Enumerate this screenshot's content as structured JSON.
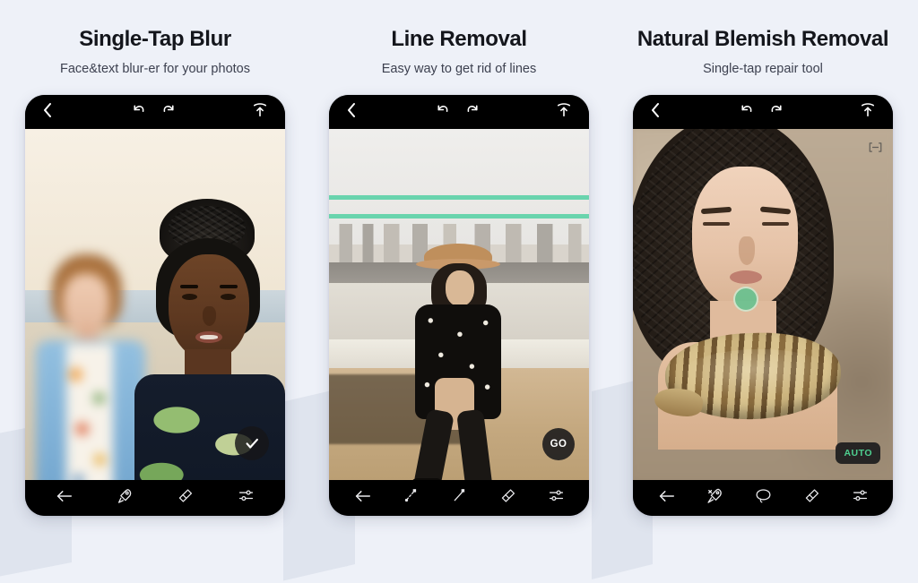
{
  "background_color": "#eef1f8",
  "panels": [
    {
      "title": "Single-Tap Blur",
      "subtitle": "Face&text blur-er for your photos",
      "topbar": {
        "back": "back-chevron-icon",
        "undo": "undo-icon",
        "redo": "redo-icon",
        "export": "export-icon"
      },
      "bottombar": [
        {
          "name": "back-arrow-icon",
          "label": "Back"
        },
        {
          "name": "blur-brush-icon",
          "label": "Blur brush"
        },
        {
          "name": "eraser-icon",
          "label": "Eraser"
        },
        {
          "name": "adjust-sliders-icon",
          "label": "Adjust"
        }
      ],
      "action": {
        "type": "check",
        "label": "✓"
      }
    },
    {
      "title": "Line Removal",
      "subtitle": "Easy way to get rid of lines",
      "topbar": {
        "back": "back-chevron-icon",
        "undo": "undo-icon",
        "redo": "redo-icon",
        "export": "export-icon"
      },
      "bottombar": [
        {
          "name": "back-arrow-icon",
          "label": "Back"
        },
        {
          "name": "dotted-line-tool-icon",
          "label": "Point line"
        },
        {
          "name": "solid-line-tool-icon",
          "label": "Straight line"
        },
        {
          "name": "eraser-icon",
          "label": "Eraser"
        },
        {
          "name": "adjust-sliders-icon",
          "label": "Adjust"
        }
      ],
      "action": {
        "type": "go",
        "label": "GO"
      },
      "overlay": {
        "line_highlight_color": "#5bd1a6",
        "line_count": 2
      }
    },
    {
      "title": "Natural Blemish Removal",
      "subtitle": "Single-tap repair tool",
      "topbar": {
        "back": "back-chevron-icon",
        "undo": "undo-icon",
        "redo": "redo-icon",
        "export": "export-icon"
      },
      "bottombar": [
        {
          "name": "back-arrow-icon",
          "label": "Back"
        },
        {
          "name": "heal-tool-icon",
          "label": "Heal"
        },
        {
          "name": "lasso-tool-icon",
          "label": "Lasso"
        },
        {
          "name": "eraser-icon",
          "label": "Eraser"
        },
        {
          "name": "adjust-sliders-icon",
          "label": "Adjust"
        }
      ],
      "action": {
        "type": "auto",
        "label": "AUTO",
        "color": "#4ecf8f"
      },
      "overlay": {
        "compare_icon": "compare-split-icon",
        "marker_color": "#48c38c"
      }
    }
  ]
}
